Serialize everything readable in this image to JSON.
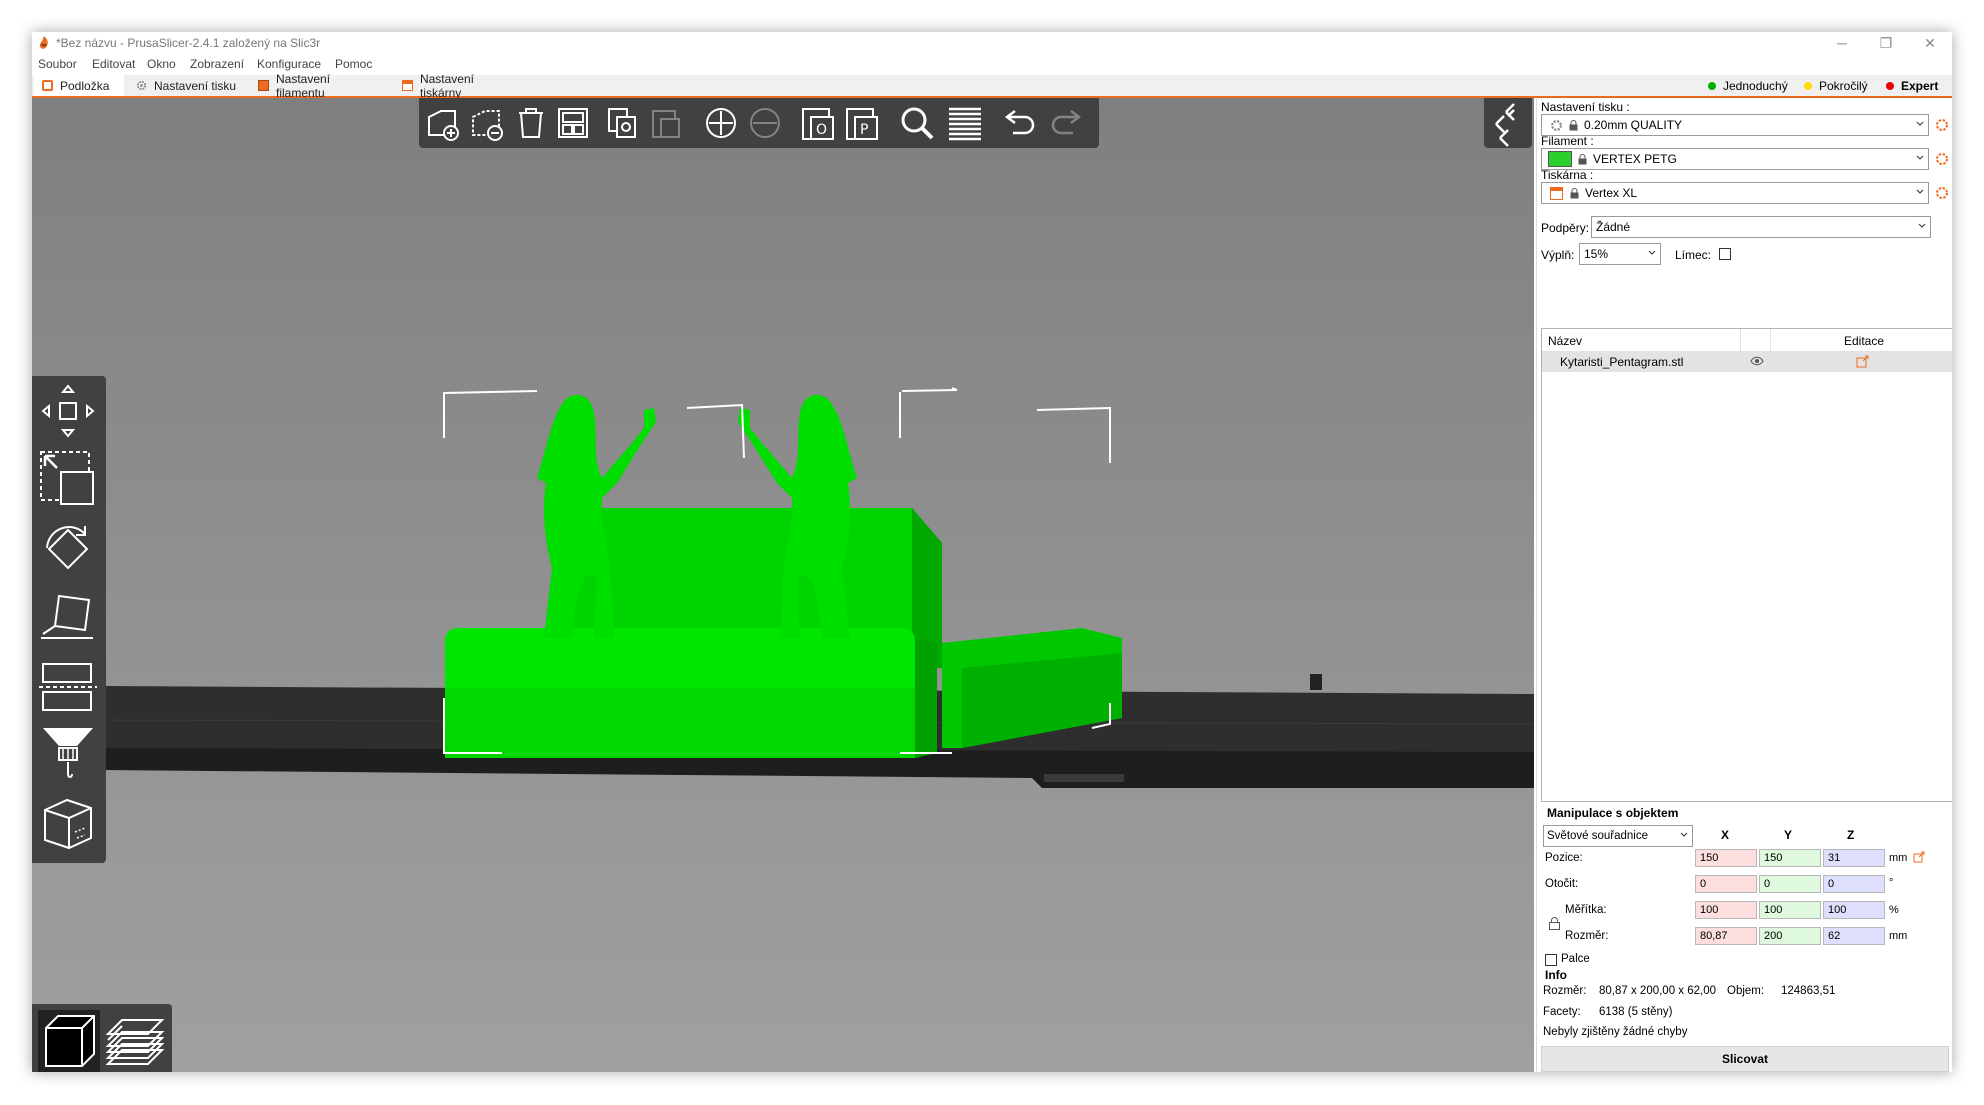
{
  "window": {
    "title": "*Bez názvu - PrusaSlicer-2.4.1 založený na Slic3r"
  },
  "menubar": {
    "items": [
      "Soubor",
      "Editovat",
      "Okno",
      "Zobrazení",
      "Konfigurace",
      "Pomoc"
    ]
  },
  "tabs": [
    {
      "label": "Podložka",
      "active": true,
      "icon": "plater-icon"
    },
    {
      "label": "Nastavení tisku",
      "active": false,
      "icon": "cog-icon"
    },
    {
      "label": "Nastavení filamentu",
      "active": false,
      "icon": "spool-icon"
    },
    {
      "label": "Nastavení tiskárny",
      "active": false,
      "icon": "printer-icon"
    }
  ],
  "modes": [
    {
      "label": "Jednoduchý",
      "color": "#00b000"
    },
    {
      "label": "Pokročilý",
      "color": "#ffdc00"
    },
    {
      "label": "Expert",
      "color": "#e70000"
    }
  ],
  "top_toolbar": {
    "buttons": [
      "add-icon",
      "delete-icon",
      "delete-all-icon",
      "arrange-icon",
      "copy-icon",
      "paste-icon",
      "add-instance-icon",
      "remove-instance-icon",
      "split-objects-icon",
      "split-parts-icon",
      "search-icon",
      "layers-editing-icon",
      "undo-icon",
      "redo-icon"
    ]
  },
  "left_toolbar": {
    "buttons": [
      "move-icon",
      "scale-icon",
      "rotate-icon",
      "place-on-face-icon",
      "cut-icon",
      "paint-supports-icon",
      "seam-icon"
    ]
  },
  "view_toolbar": {
    "buttons": [
      "3d-view-icon",
      "preview-icon"
    ]
  },
  "sidebar": {
    "print_settings_label": "Nastavení tisku :",
    "print_settings_value": "0.20mm QUALITY",
    "filament_label": "Filament :",
    "filament_value": "VERTEX PETG",
    "filament_color": "#2bd02b",
    "printer_label": "Tiskárna :",
    "printer_value": "Vertex XL",
    "supports_label": "Podpěry:",
    "supports_value": "Žádné",
    "infill_label": "Výplň:",
    "infill_value": "15%",
    "brim_label": "Límec:",
    "brim_checked": false,
    "object_list": {
      "col_name": "Název",
      "col_edit": "Editace",
      "rows": [
        {
          "name": "Kytaristi_Pentagram.stl"
        }
      ]
    },
    "manipulation": {
      "title": "Manipulace s objektem",
      "coordinates": "Světové souřadnice",
      "axis_x": "X",
      "axis_y": "Y",
      "axis_z": "Z",
      "position_label": "Pozice:",
      "position": [
        "150",
        "150",
        "31"
      ],
      "position_unit": "mm",
      "rotation_label": "Otočit:",
      "rotation": [
        "0",
        "0",
        "0"
      ],
      "rotation_unit": "°",
      "scale_label": "Měřítka:",
      "scale": [
        "100",
        "100",
        "100"
      ],
      "scale_unit": "%",
      "size_label": "Rozměr:",
      "size": [
        "80,87",
        "200",
        "62"
      ],
      "size_unit": "mm",
      "inches_label": "Palce",
      "inches_checked": false
    },
    "info": {
      "title": "Info",
      "size_label": "Rozměr:",
      "size_value": "80,87 x 200,00 x 62,00",
      "volume_label": "Objem:",
      "volume_value": "124863,51",
      "facets_label": "Facety:",
      "facets_value": "6138 (5 stěny)",
      "errors": "Nebyly zjištěny žádné chyby"
    },
    "slice_button": "Slicovat"
  },
  "colors": {
    "accent": "#ed6b21",
    "model": "#00e600",
    "toolbar_bg": "#414141"
  }
}
